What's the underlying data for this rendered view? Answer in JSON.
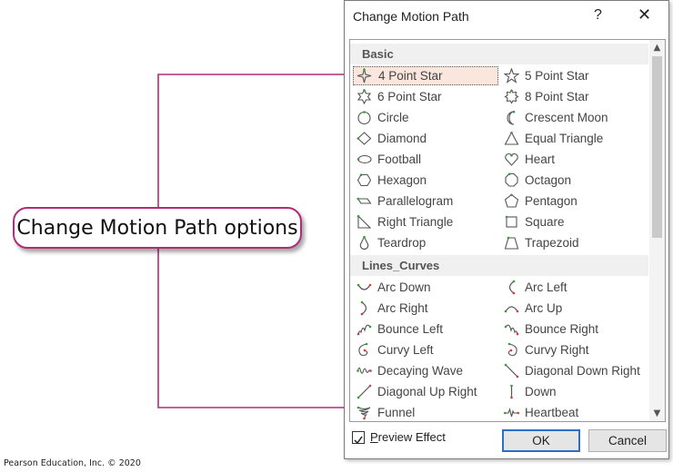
{
  "dialog": {
    "title": "Change Motion Path",
    "help_label": "?",
    "close_label": "✕",
    "groups": [
      {
        "label": "Basic",
        "items": [
          {
            "label": "4 Point Star",
            "icon": "four-point-star-icon",
            "selected": true
          },
          {
            "label": "5 Point Star",
            "icon": "five-point-star-icon"
          },
          {
            "label": "6 Point Star",
            "icon": "six-point-star-icon"
          },
          {
            "label": "8 Point Star",
            "icon": "eight-point-star-icon"
          },
          {
            "label": "Circle",
            "icon": "circle-icon"
          },
          {
            "label": "Crescent Moon",
            "icon": "crescent-moon-icon"
          },
          {
            "label": "Diamond",
            "icon": "diamond-icon"
          },
          {
            "label": "Equal Triangle",
            "icon": "equal-triangle-icon"
          },
          {
            "label": "Football",
            "icon": "football-icon"
          },
          {
            "label": "Heart",
            "icon": "heart-icon"
          },
          {
            "label": "Hexagon",
            "icon": "hexagon-icon"
          },
          {
            "label": "Octagon",
            "icon": "octagon-icon"
          },
          {
            "label": "Parallelogram",
            "icon": "parallelogram-icon"
          },
          {
            "label": "Pentagon",
            "icon": "pentagon-icon"
          },
          {
            "label": "Right Triangle",
            "icon": "right-triangle-icon"
          },
          {
            "label": "Square",
            "icon": "square-icon"
          },
          {
            "label": "Teardrop",
            "icon": "teardrop-icon"
          },
          {
            "label": "Trapezoid",
            "icon": "trapezoid-icon"
          }
        ]
      },
      {
        "label": "Lines_Curves",
        "items": [
          {
            "label": "Arc Down",
            "icon": "arc-down-icon"
          },
          {
            "label": "Arc Left",
            "icon": "arc-left-icon"
          },
          {
            "label": "Arc Right",
            "icon": "arc-right-icon"
          },
          {
            "label": "Arc Up",
            "icon": "arc-up-icon"
          },
          {
            "label": "Bounce Left",
            "icon": "bounce-left-icon"
          },
          {
            "label": "Bounce Right",
            "icon": "bounce-right-icon"
          },
          {
            "label": "Curvy Left",
            "icon": "curvy-left-icon"
          },
          {
            "label": "Curvy Right",
            "icon": "curvy-right-icon"
          },
          {
            "label": "Decaying Wave",
            "icon": "decaying-wave-icon"
          },
          {
            "label": "Diagonal Down Right",
            "icon": "diagonal-down-right-icon"
          },
          {
            "label": "Diagonal Up Right",
            "icon": "diagonal-up-right-icon"
          },
          {
            "label": "Down",
            "icon": "down-icon"
          },
          {
            "label": "Funnel",
            "icon": "funnel-icon"
          },
          {
            "label": "Heartbeat",
            "icon": "heartbeat-icon"
          }
        ]
      }
    ],
    "preview_effect": {
      "label_first": "P",
      "label_rest": "review Effect",
      "checked": true
    },
    "ok_label": "OK",
    "cancel_label": "Cancel"
  },
  "callout": {
    "label": "Change Motion Path options"
  },
  "credit": "Pearson Education, Inc. © 2020",
  "colors": {
    "callout_border": "#b12b78",
    "path_green": "#3a9a3a",
    "path_red": "#d23b3b",
    "selection": "#fbe6de",
    "ok_border": "#2e6fc6"
  }
}
